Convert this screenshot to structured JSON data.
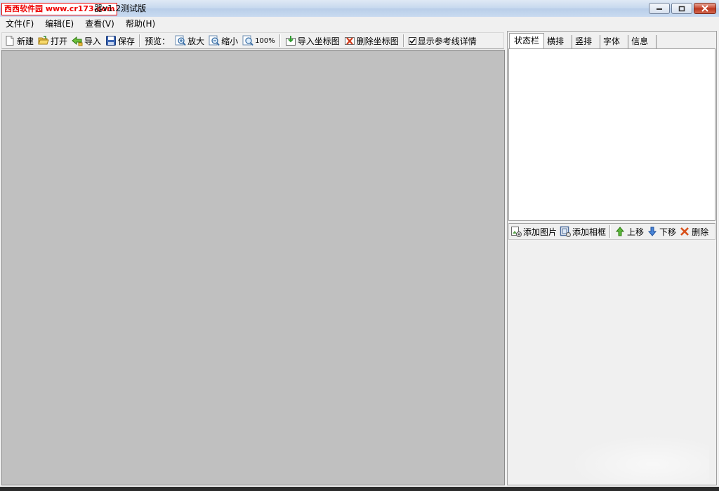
{
  "window": {
    "watermark_site": "西西软件园",
    "watermark_url": "www.cr173.com",
    "title": "器v1.2测试版"
  },
  "menu": [
    {
      "label": "文件(F)"
    },
    {
      "label": "编辑(E)"
    },
    {
      "label": "查看(V)"
    },
    {
      "label": "帮助(H)"
    }
  ],
  "toolbar": {
    "new": "新建",
    "open": "打开",
    "import": "导入",
    "save": "保存",
    "preview_label": "预览：",
    "zoom_in": "放大",
    "zoom_out": "缩小",
    "zoom_100": "100%",
    "import_coord_map": "导入坐标图",
    "delete_coord_map": "删除坐标图",
    "show_guides": "显示参考线详情",
    "show_guides_checked": true
  },
  "panel": {
    "tabs": [
      {
        "label": "状态栏",
        "active": true
      },
      {
        "label": "横排"
      },
      {
        "label": "竖排"
      },
      {
        "label": "字体"
      },
      {
        "label": "信息"
      }
    ],
    "tools": {
      "add_image": "添加图片",
      "add_frame": "添加相框",
      "move_up": "上移",
      "move_down": "下移",
      "delete": "删除"
    }
  },
  "colors": {
    "canvas": "#c0c0c0",
    "window_bg": "#f0f0f0",
    "close_button": "#c7432b",
    "watermark": "#e00000"
  }
}
